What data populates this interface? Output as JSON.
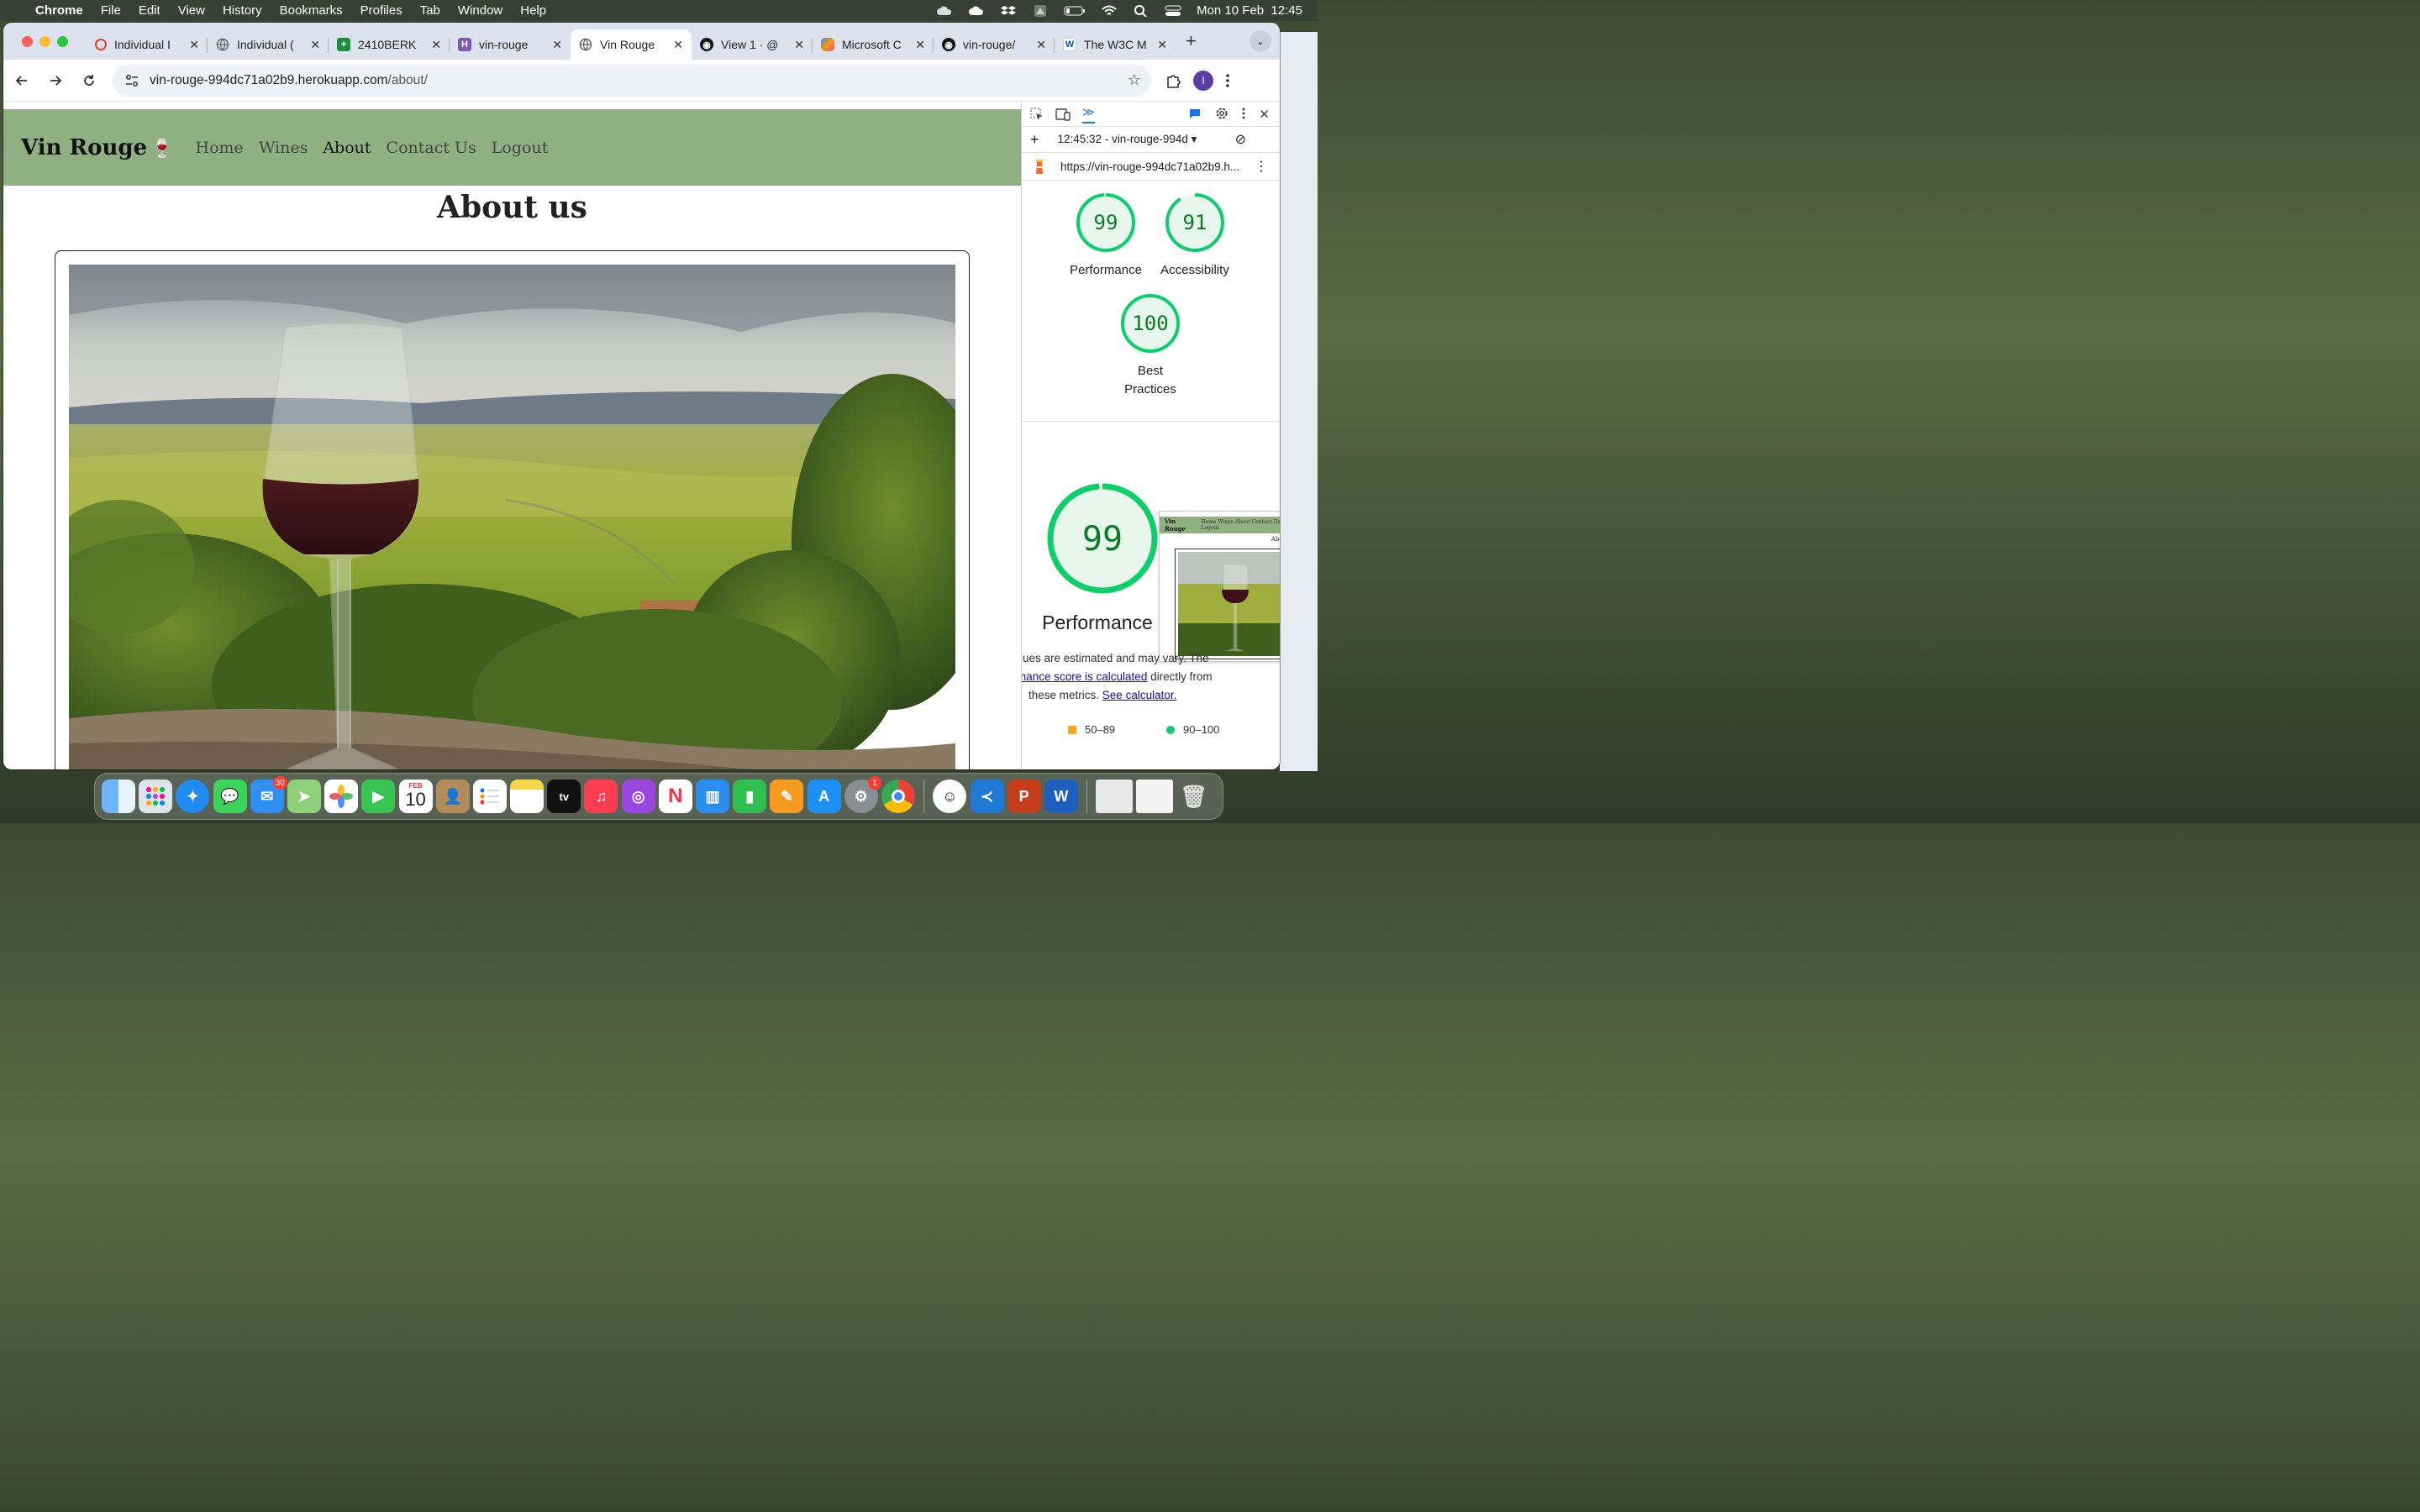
{
  "menubar": {
    "app_name": "Chrome",
    "menus": [
      "File",
      "Edit",
      "View",
      "History",
      "Bookmarks",
      "Profiles",
      "Tab",
      "Window",
      "Help"
    ],
    "clock": "Mon 10 Feb  12:45"
  },
  "tabs": [
    {
      "label": "Individual I",
      "favicon": "opera-icon",
      "color": "#e0442e"
    },
    {
      "label": "Individual (",
      "favicon": "globe-icon",
      "color": "#5f6368"
    },
    {
      "label": "2410BERK",
      "favicon": "sheets-icon",
      "color": "#1e8e3e"
    },
    {
      "label": "vin-rouge",
      "favicon": "heroku-icon",
      "color": "#7b59b6"
    },
    {
      "label": "Vin Rouge",
      "favicon": "globe-icon",
      "color": "#5f6368",
      "active": true
    },
    {
      "label": "View 1 · @",
      "favicon": "github-icon",
      "color": "#111"
    },
    {
      "label": "Microsoft C",
      "favicon": "copilot-icon",
      "color": "#3b82f6"
    },
    {
      "label": "vin-rouge/",
      "favicon": "github-icon",
      "color": "#111"
    },
    {
      "label": "The W3C M",
      "favicon": "w3c-icon",
      "color": "#005a9c"
    }
  ],
  "omnibox": {
    "host": "vin-rouge-994dc71a02b9.herokuapp.com",
    "path": "/about/"
  },
  "profile_initial": "I",
  "site": {
    "brand": "Vin Rouge",
    "brand_emoji": "🍷",
    "nav": [
      "Home",
      "Wines",
      "About",
      "Contact Us",
      "Logout"
    ],
    "current_nav": "About",
    "page_title": "About us",
    "nav_color": "#8fb080"
  },
  "devtools": {
    "report_label": "12:45:32 - vin-rouge-994d",
    "audited_url": "https://vin-rouge-994dc71a02b9.h...",
    "scores": [
      {
        "label": "Performance",
        "value": 99
      },
      {
        "label": "Accessibility",
        "value": 91
      },
      {
        "label": "Best Practices",
        "value": 100
      }
    ],
    "big_score": {
      "label": "Performance",
      "value": 99
    },
    "thumb": {
      "brand": "Vin Rouge",
      "nav": "Home  Wines  About  Contact Us  Logout",
      "title": "About"
    },
    "note_line1": "ues are estimated and may vary. The",
    "note_link1": "mance score is calculated",
    "note_line2_rest": " directly from",
    "note_line3": "these metrics.",
    "note_link2": "See calculator.",
    "legend": [
      {
        "shape": "square",
        "range": "50–89",
        "color": "#f5a623"
      },
      {
        "shape": "circle",
        "range": "90–100",
        "color": "#0cce6b"
      }
    ],
    "good_color": "#0cce6b"
  },
  "dock": {
    "mail_badge": "30",
    "calendar_month": "FEB",
    "calendar_day": "10",
    "settings_badge": "1"
  }
}
